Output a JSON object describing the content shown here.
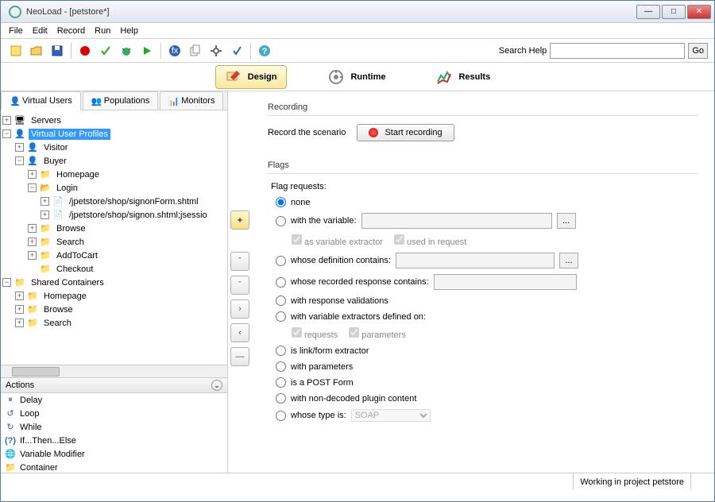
{
  "window": {
    "title": "NeoLoad - [petstore*]"
  },
  "menu": {
    "file": "File",
    "edit": "Edit",
    "record": "Record",
    "run": "Run",
    "help": "Help"
  },
  "search": {
    "label": "Search Help",
    "go": "Go",
    "value": ""
  },
  "modes": {
    "design": "Design",
    "runtime": "Runtime",
    "results": "Results"
  },
  "tabs": {
    "virtual_users": "Virtual Users",
    "populations": "Populations",
    "monitors": "Monitors"
  },
  "tree": {
    "servers": "Servers",
    "vup": "Virtual User Profiles",
    "visitor": "Visitor",
    "buyer": "Buyer",
    "homepage": "Homepage",
    "login": "Login",
    "req1": "/jpetstore/shop/signonForm.shtml",
    "req2": "/jpetstore/shop/signon.shtml;jsessio",
    "browse": "Browse",
    "search": "Search",
    "addtocart": "AddToCart",
    "checkout": "Checkout",
    "shared": "Shared Containers",
    "sc_homepage": "Homepage",
    "sc_browse": "Browse",
    "sc_search": "Search"
  },
  "actions": {
    "title": "Actions",
    "items": {
      "delay": "Delay",
      "loop": "Loop",
      "while": "While",
      "ifthenelse": "If...Then...Else",
      "varmod": "Variable Modifier",
      "container": "Container"
    }
  },
  "recording": {
    "group": "Recording",
    "label": "Record the scenario",
    "button": "Start recording"
  },
  "flags": {
    "group": "Flags",
    "label": "Flag requests:",
    "none": "none",
    "with_variable": "with the variable:",
    "as_var_extractor": "as variable extractor",
    "used_in_request": "used in request",
    "def_contains": "whose definition contains:",
    "resp_contains": "whose recorded response contains:",
    "resp_valid": "with response validations",
    "var_extractors_on": "with variable extractors defined on:",
    "requests": "requests",
    "parameters": "parameters",
    "link_form": "is link/form extractor",
    "with_params": "with parameters",
    "post_form": "is a POST Form",
    "non_decoded": "with non-decoded plugin content",
    "whose_type": "whose type is:",
    "type_value": "SOAP"
  },
  "status": {
    "project": "Working in project petstore"
  }
}
